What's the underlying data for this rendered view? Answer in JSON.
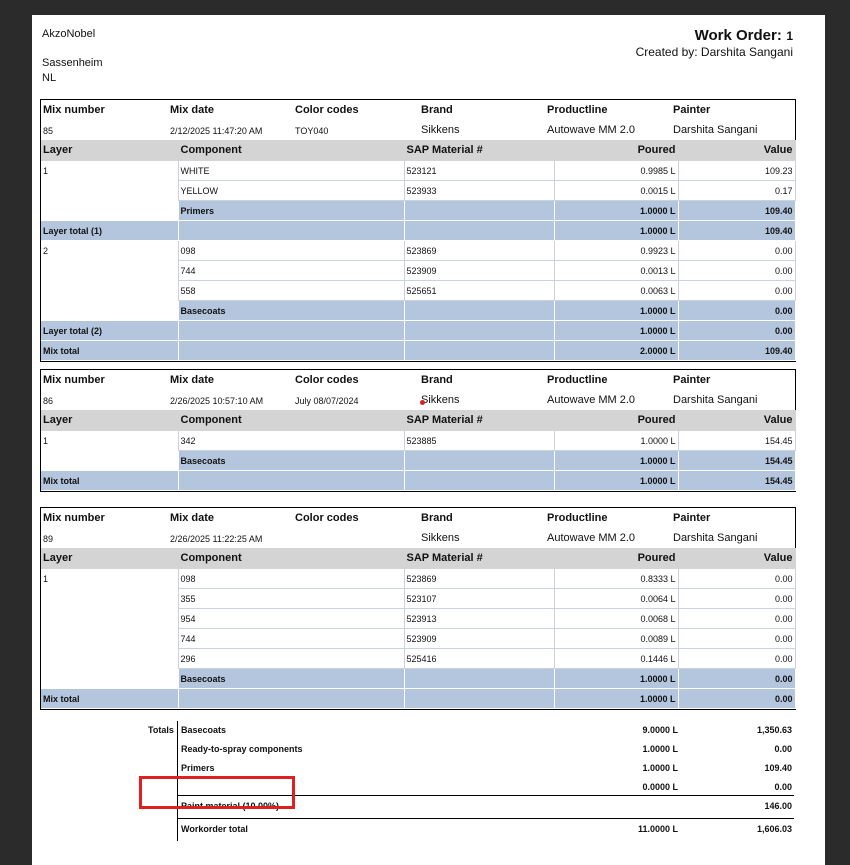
{
  "company": {
    "name": "AkzoNobel",
    "city": "Sassenheim",
    "country": "NL"
  },
  "header": {
    "title": "Work Order:",
    "number": "1",
    "created_by": "Created by: Darshita Sangani"
  },
  "labels": {
    "mix_number": "Mix number",
    "mix_date": "Mix date",
    "color_codes": "Color codes",
    "brand": "Brand",
    "productline": "Productline",
    "painter": "Painter",
    "layer": "Layer",
    "component": "Component",
    "sap": "SAP Material #",
    "poured": "Poured",
    "value": "Value"
  },
  "mixes": [
    {
      "mix_number": "85",
      "mix_date": "2/12/2025 11:47:20 AM",
      "color_codes": "TOY040",
      "brand": "Sikkens",
      "productline": "Autowave MM 2.0",
      "painter": "Darshita Sangani",
      "rows": [
        {
          "type": "comp",
          "layer": "1",
          "component": "WHITE",
          "sap": "523121",
          "poured": "0.9985 L",
          "value": "109.23"
        },
        {
          "type": "comp",
          "layer": "",
          "component": "YELLOW",
          "sap": "523933",
          "poured": "0.0015 L",
          "value": "0.17"
        },
        {
          "type": "sub",
          "label": "Primers",
          "poured": "1.0000 L",
          "value": "109.40"
        },
        {
          "type": "total",
          "label": "Layer total (1)",
          "poured": "1.0000 L",
          "value": "109.40"
        },
        {
          "type": "comp",
          "layer": "2",
          "component": "098",
          "sap": "523869",
          "poured": "0.9923 L",
          "value": "0.00"
        },
        {
          "type": "comp",
          "layer": "",
          "component": "744",
          "sap": "523909",
          "poured": "0.0013 L",
          "value": "0.00"
        },
        {
          "type": "comp",
          "layer": "",
          "component": "558",
          "sap": "525651",
          "poured": "0.0063 L",
          "value": "0.00"
        },
        {
          "type": "sub",
          "label": "Basecoats",
          "poured": "1.0000 L",
          "value": "0.00"
        },
        {
          "type": "total",
          "label": "Layer total (2)",
          "poured": "1.0000 L",
          "value": "0.00"
        },
        {
          "type": "total",
          "label": "Mix total",
          "poured": "2.0000 L",
          "value": "109.40"
        }
      ]
    },
    {
      "mix_number": "86",
      "mix_date": "2/26/2025 10:57:10 AM",
      "color_codes": "July 08/07/2024",
      "brand": "Sikkens",
      "productline": "Autowave MM 2.0",
      "painter": "Darshita Sangani",
      "rows": [
        {
          "type": "comp",
          "layer": "1",
          "component": "342",
          "sap": "523885",
          "poured": "1.0000 L",
          "value": "154.45"
        },
        {
          "type": "sub",
          "label": "Basecoats",
          "poured": "1.0000 L",
          "value": "154.45"
        },
        {
          "type": "total",
          "label": "Mix total",
          "poured": "1.0000 L",
          "value": "154.45"
        }
      ]
    },
    {
      "mix_number": "89",
      "mix_date": "2/26/2025 11:22:25 AM",
      "color_codes": "",
      "brand": "Sikkens",
      "productline": "Autowave MM 2.0",
      "painter": "Darshita Sangani",
      "rows": [
        {
          "type": "comp",
          "layer": "1",
          "component": "098",
          "sap": "523869",
          "poured": "0.8333 L",
          "value": "0.00"
        },
        {
          "type": "comp",
          "layer": "",
          "component": "355",
          "sap": "523107",
          "poured": "0.0064 L",
          "value": "0.00"
        },
        {
          "type": "comp",
          "layer": "",
          "component": "954",
          "sap": "523913",
          "poured": "0.0068 L",
          "value": "0.00"
        },
        {
          "type": "comp",
          "layer": "",
          "component": "744",
          "sap": "523909",
          "poured": "0.0089 L",
          "value": "0.00"
        },
        {
          "type": "comp",
          "layer": "",
          "component": "296",
          "sap": "525416",
          "poured": "0.1446 L",
          "value": "0.00"
        },
        {
          "type": "sub",
          "label": "Basecoats",
          "poured": "1.0000 L",
          "value": "0.00"
        },
        {
          "type": "total",
          "label": "Mix total",
          "poured": "1.0000 L",
          "value": "0.00"
        }
      ]
    }
  ],
  "totals": {
    "label": "Totals",
    "rows": [
      {
        "label": "Basecoats",
        "poured": "9.0000 L",
        "value": "1,350.63"
      },
      {
        "label": "Ready-to-spray components",
        "poured": "1.0000 L",
        "value": "0.00"
      },
      {
        "label": "Primers",
        "poured": "1.0000 L",
        "value": "109.40"
      },
      {
        "label": "",
        "poured": "0.0000 L",
        "value": "0.00"
      }
    ],
    "paint_material": {
      "label": "Paint material (10.00%)",
      "value": "146.00"
    },
    "workorder": {
      "label": "Workorder total",
      "poured": "11.0000 L",
      "value": "1,606.03"
    }
  },
  "colors": {
    "header_gray": "#d4d4d4",
    "subtotal_blue": "#b4c6de",
    "highlight_red": "#e02020"
  }
}
